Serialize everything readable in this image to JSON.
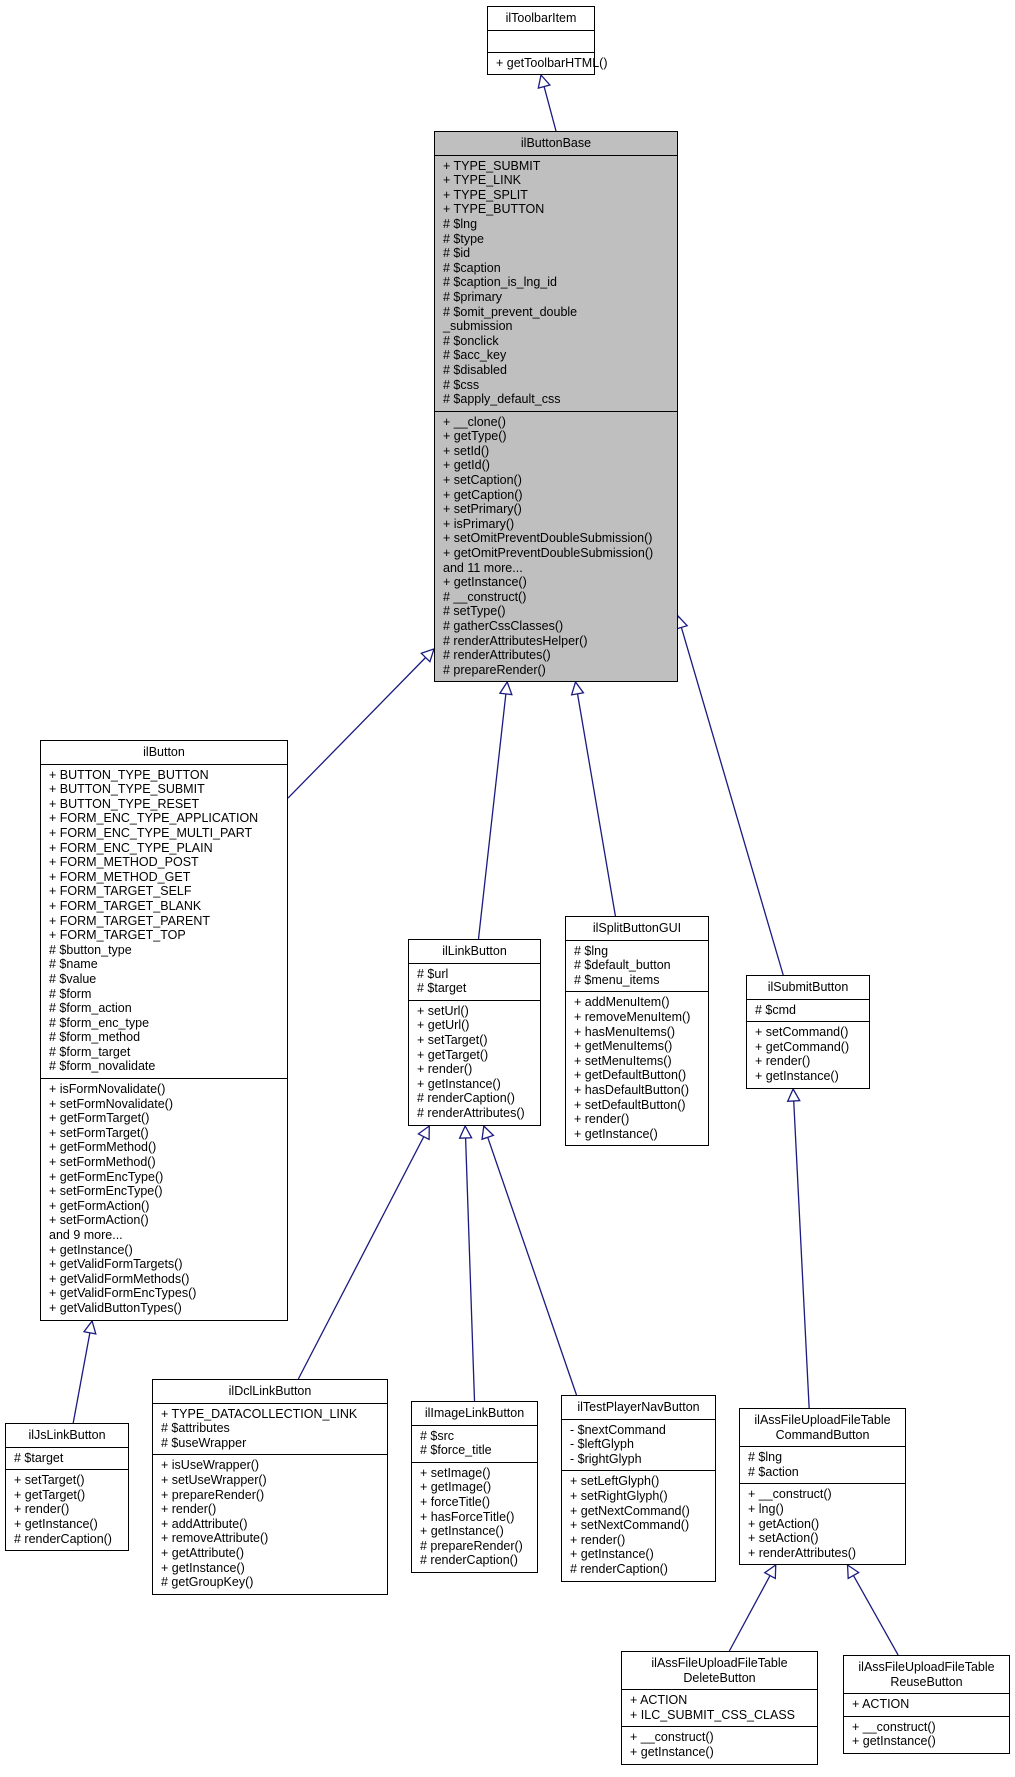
{
  "diagram": {
    "edge_color": "#1a1a80",
    "focus_fill": "#bfbfbf",
    "classes": {
      "ilToolbarItem": {
        "title": "ilToolbarItem",
        "attributes": [],
        "methods": [
          "+ getToolbarHTML()"
        ]
      },
      "ilButtonBase": {
        "title": "ilButtonBase",
        "attributes": [
          "+ TYPE_SUBMIT",
          "+ TYPE_LINK",
          "+ TYPE_SPLIT",
          "+ TYPE_BUTTON",
          "# $lng",
          "# $type",
          "# $id",
          "# $caption",
          "# $caption_is_lng_id",
          "# $primary",
          "# $omit_prevent_double",
          "_submission",
          "# $onclick",
          "# $acc_key",
          "# $disabled",
          "# $css",
          "# $apply_default_css"
        ],
        "methods": [
          "+ __clone()",
          "+ getType()",
          "+ setId()",
          "+ getId()",
          "+ setCaption()",
          "+ getCaption()",
          "+ setPrimary()",
          "+ isPrimary()",
          "+ setOmitPreventDoubleSubmission()",
          "+ getOmitPreventDoubleSubmission()",
          "and 11 more...",
          "+ getInstance()",
          "# __construct()",
          "# setType()",
          "# gatherCssClasses()",
          "# renderAttributesHelper()",
          "# renderAttributes()",
          "# prepareRender()"
        ]
      },
      "ilButton": {
        "title": "ilButton",
        "attributes": [
          "+ BUTTON_TYPE_BUTTON",
          "+ BUTTON_TYPE_SUBMIT",
          "+ BUTTON_TYPE_RESET",
          "+ FORM_ENC_TYPE_APPLICATION",
          "+ FORM_ENC_TYPE_MULTI_PART",
          "+ FORM_ENC_TYPE_PLAIN",
          "+ FORM_METHOD_POST",
          "+ FORM_METHOD_GET",
          "+ FORM_TARGET_SELF",
          "+ FORM_TARGET_BLANK",
          "+ FORM_TARGET_PARENT",
          "+ FORM_TARGET_TOP",
          "# $button_type",
          "# $name",
          "# $value",
          "# $form",
          "# $form_action",
          "# $form_enc_type",
          "# $form_method",
          "# $form_target",
          "# $form_novalidate"
        ],
        "methods": [
          "+ isFormNovalidate()",
          "+ setFormNovalidate()",
          "+ getFormTarget()",
          "+ setFormTarget()",
          "+ getFormMethod()",
          "+ setFormMethod()",
          "+ getFormEncType()",
          "+ setFormEncType()",
          "+ getFormAction()",
          "+ setFormAction()",
          "and 9 more...",
          "+ getInstance()",
          "+ getValidFormTargets()",
          "+ getValidFormMethods()",
          "+ getValidFormEncTypes()",
          "+ getValidButtonTypes()"
        ]
      },
      "ilLinkButton": {
        "title": "ilLinkButton",
        "attributes": [
          "# $url",
          "# $target"
        ],
        "methods": [
          "+ setUrl()",
          "+ getUrl()",
          "+ setTarget()",
          "+ getTarget()",
          "+ render()",
          "+ getInstance()",
          "# renderCaption()",
          "# renderAttributes()"
        ]
      },
      "ilSplitButtonGUI": {
        "title": "ilSplitButtonGUI",
        "attributes": [
          "# $lng",
          "# $default_button",
          "# $menu_items"
        ],
        "methods": [
          "+ addMenuItem()",
          "+ removeMenuItem()",
          "+ hasMenuItems()",
          "+ getMenuItems()",
          "+ setMenuItems()",
          "+ getDefaultButton()",
          "+ hasDefaultButton()",
          "+ setDefaultButton()",
          "+ render()",
          "+ getInstance()"
        ]
      },
      "ilSubmitButton": {
        "title": "ilSubmitButton",
        "attributes": [
          "# $cmd"
        ],
        "methods": [
          "+ setCommand()",
          "+ getCommand()",
          "+ render()",
          "+ getInstance()"
        ]
      },
      "ilJsLinkButton": {
        "title": "ilJsLinkButton",
        "attributes": [
          "# $target"
        ],
        "methods": [
          "+ setTarget()",
          "+ getTarget()",
          "+ render()",
          "+ getInstance()",
          "# renderCaption()"
        ]
      },
      "ilDclLinkButton": {
        "title": "ilDclLinkButton",
        "attributes": [
          "+ TYPE_DATACOLLECTION_LINK",
          "# $attributes",
          "# $useWrapper"
        ],
        "methods": [
          "+ isUseWrapper()",
          "+ setUseWrapper()",
          "+ prepareRender()",
          "+ render()",
          "+ addAttribute()",
          "+ removeAttribute()",
          "+ getAttribute()",
          "+ getInstance()",
          "# getGroupKey()"
        ]
      },
      "ilImageLinkButton": {
        "title": "ilImageLinkButton",
        "attributes": [
          "# $src",
          "# $force_title"
        ],
        "methods": [
          "+ setImage()",
          "+ getImage()",
          "+ forceTitle()",
          "+ hasForceTitle()",
          "+ getInstance()",
          "# prepareRender()",
          "# renderCaption()"
        ]
      },
      "ilTestPlayerNavButton": {
        "title": "ilTestPlayerNavButton",
        "attributes": [
          "- $nextCommand",
          "- $leftGlyph",
          "- $rightGlyph"
        ],
        "methods": [
          "+ setLeftGlyph()",
          "+ setRightGlyph()",
          "+ getNextCommand()",
          "+ setNextCommand()",
          "+ render()",
          "+ getInstance()",
          "# renderCaption()"
        ]
      },
      "ilAssFileUploadFileTableCommandButton": {
        "title": "ilAssFileUploadFileTable\nCommandButton",
        "attributes": [
          "# $lng",
          "# $action"
        ],
        "methods": [
          "+ __construct()",
          "+ lng()",
          "+ getAction()",
          "+ setAction()",
          "+ renderAttributes()"
        ]
      },
      "ilAssFileUploadFileTableDeleteButton": {
        "title": "ilAssFileUploadFileTable\nDeleteButton",
        "attributes": [
          "+ ACTION",
          "+ ILC_SUBMIT_CSS_CLASS"
        ],
        "methods": [
          "+ __construct()",
          "+ getInstance()"
        ]
      },
      "ilAssFileUploadFileTableReuseButton": {
        "title": "ilAssFileUploadFileTable\nReuseButton",
        "attributes": [
          "+ ACTION"
        ],
        "methods": [
          "+ __construct()",
          "+ getInstance()"
        ]
      }
    },
    "edges": [
      {
        "from": "ilButtonBase",
        "to": "ilToolbarItem",
        "type": "inheritance"
      },
      {
        "from": "ilButton",
        "to": "ilButtonBase",
        "type": "inheritance"
      },
      {
        "from": "ilLinkButton",
        "to": "ilButtonBase",
        "type": "inheritance"
      },
      {
        "from": "ilSplitButtonGUI",
        "to": "ilButtonBase",
        "type": "inheritance"
      },
      {
        "from": "ilSubmitButton",
        "to": "ilButtonBase",
        "type": "inheritance"
      },
      {
        "from": "ilJsLinkButton",
        "to": "ilButton",
        "type": "inheritance"
      },
      {
        "from": "ilDclLinkButton",
        "to": "ilLinkButton",
        "type": "inheritance"
      },
      {
        "from": "ilImageLinkButton",
        "to": "ilLinkButton",
        "type": "inheritance"
      },
      {
        "from": "ilTestPlayerNavButton",
        "to": "ilLinkButton",
        "type": "inheritance"
      },
      {
        "from": "ilAssFileUploadFileTableCommandButton",
        "to": "ilSubmitButton",
        "type": "inheritance"
      },
      {
        "from": "ilAssFileUploadFileTableDeleteButton",
        "to": "ilAssFileUploadFileTableCommandButton",
        "type": "inheritance"
      },
      {
        "from": "ilAssFileUploadFileTableReuseButton",
        "to": "ilAssFileUploadFileTableCommandButton",
        "type": "inheritance"
      }
    ]
  }
}
